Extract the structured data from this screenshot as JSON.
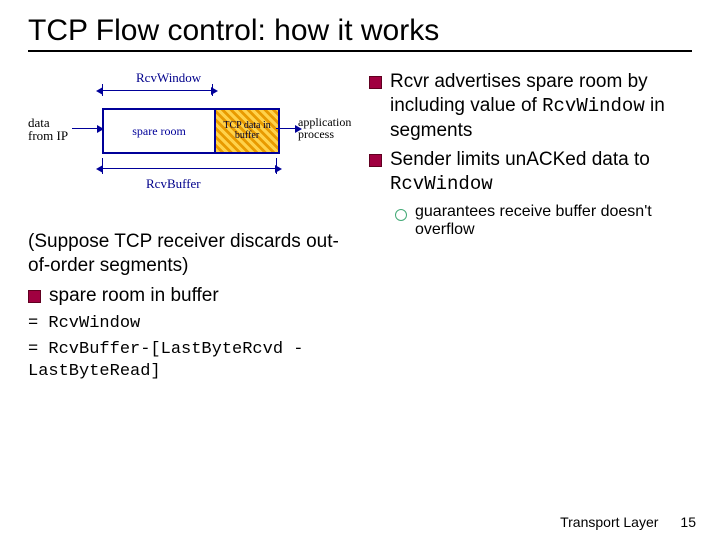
{
  "title": "TCP Flow control: how it works",
  "diagram": {
    "rcvwindow_label": "RcvWindow",
    "spare_room": "spare room",
    "tcp_data": "TCP data in buffer",
    "data_from": "data from IP",
    "app_proc": "application process",
    "rcvbuffer_label": "RcvBuffer"
  },
  "left": {
    "suppose": "(Suppose TCP receiver discards out-of-order segments)",
    "bullet1": "spare room in buffer",
    "eq1": "= RcvWindow",
    "eq2": "= RcvBuffer-[LastByteRcvd - LastByteRead]"
  },
  "right": {
    "bullet1a": "Rcvr advertises spare room by including value of ",
    "bullet1b": "RcvWindow",
    "bullet1c": " in segments",
    "bullet2a": "Sender limits unACKed data to ",
    "bullet2b": "RcvWindow",
    "sub1": "guarantees receive buffer doesn't overflow"
  },
  "footer": {
    "layer": "Transport Layer",
    "page": "15"
  }
}
